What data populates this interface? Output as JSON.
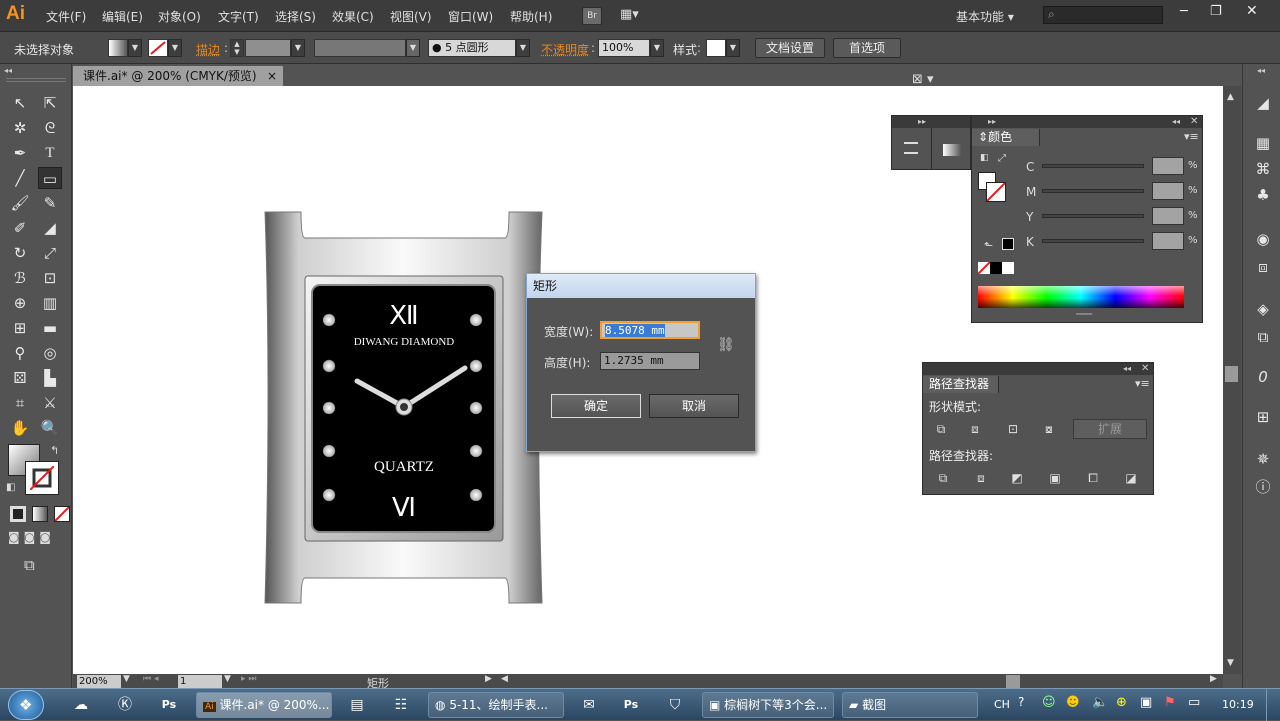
{
  "app": {
    "logo": "Ai",
    "workspace": "基本功能",
    "window_controls": [
      "─",
      "❐",
      "✕"
    ]
  },
  "menu": {
    "items": [
      "文件(F)",
      "编辑(E)",
      "对象(O)",
      "文字(T)",
      "选择(S)",
      "效果(C)",
      "视图(V)",
      "窗口(W)",
      "帮助(H)"
    ],
    "br_label": "Br"
  },
  "control_bar": {
    "selection": "未选择对象",
    "stroke_label": "描边",
    "brush_dot": "●",
    "brush_value": "5 点圆形",
    "opacity_label": "不透明度",
    "opacity_value": "100%",
    "style_label": "样式",
    "doc_setup": "文档设置",
    "preferences": "首选项"
  },
  "document": {
    "tab_label": "课件.ai* @ 200% (CMYK/预览)",
    "tab_close": "×"
  },
  "watch": {
    "twelve": "Ⅻ",
    "six": "Ⅵ",
    "brand": "DIWANG DIAMOND",
    "quartz": "QUARTZ"
  },
  "dialog": {
    "title": "矩形",
    "width_label": "宽度(W):",
    "width_value": "8.5078 mm",
    "height_label": "高度(H):",
    "height_value": "1.2735 mm",
    "ok": "确定",
    "cancel": "取消"
  },
  "color_panel": {
    "title": "颜色",
    "channels": [
      "C",
      "M",
      "Y",
      "K"
    ],
    "percent": "%"
  },
  "pathfinder_panel": {
    "title": "路径查找器",
    "shape_modes": "形状模式:",
    "expand": "扩展",
    "pathfinders": "路径查找器:"
  },
  "status": {
    "zoom": "200%",
    "page": "1",
    "tool": "矩形"
  },
  "taskbar": {
    "items": [
      "课件.ai* @ 200%...",
      "5-11、绘制手表...",
      "棕榈树下等3个会...",
      "截图"
    ],
    "tray": {
      "lang": "CH",
      "time": "10:19"
    }
  },
  "colors": {
    "accent_orange": "#f7931e",
    "selection_blue": "#3a7bd5"
  }
}
